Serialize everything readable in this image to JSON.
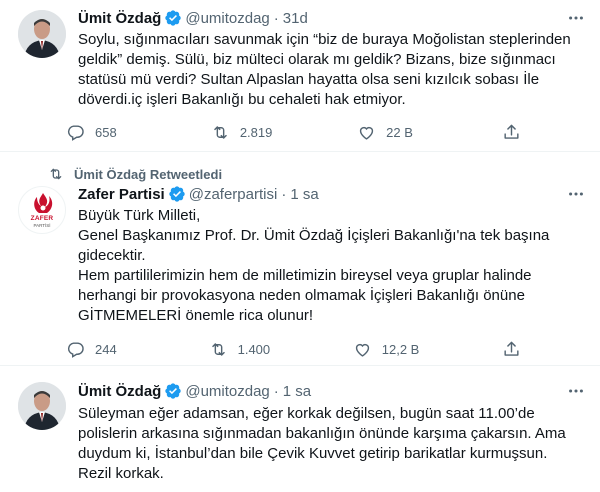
{
  "tweets": [
    {
      "name": "Ümit Özdağ",
      "handle": "@umitozdag",
      "dot": "·",
      "time": "31d",
      "text": "Soylu, sığınmacıları savunmak için “biz de buraya Moğolistan steplerinden\ngeldik” demiş. Sülü, biz mülteci olarak mı geldik? Bizans, bize sığınmacı\nstatüsü mü verdi? Sultan Alpaslan hayatta olsa seni kızılcık sobası İle\ndöverdi.iç işleri Bakanlığı bu cehaleti hak etmiyor.",
      "replies": "658",
      "retweets": "2.819",
      "likes": "22 B",
      "share": ""
    },
    {
      "retweeted_by": "Ümit Özdağ Retweetledi",
      "name": "Zafer Partisi",
      "handle": "@zaferpartisi",
      "dot": "·",
      "time": "1 sa",
      "logo_text": "ZAFER",
      "logo_subtext": "PARTİSİ",
      "text": "Büyük Türk Milleti,\nGenel Başkanımız Prof. Dr. Ümit Özdağ İçişleri Bakanlığı'na tek başına\ngidecektir.\nHem partililerimizin hem de milletimizin bireysel veya gruplar halinde\nherhangi bir provokasyona neden olmamak İçişleri Bakanlığı önüne\nGİTMEMELERİ önemle rica olunur!",
      "replies": "244",
      "retweets": "1.400",
      "likes": "12,2 B",
      "share": ""
    },
    {
      "name": "Ümit Özdağ",
      "handle": "@umitozdag",
      "dot": "·",
      "time": "1 sa",
      "text": "Süleyman eğer adamsan, eğer korkak değilsen, bugün saat 11.00’de\npolislerin arkasına sığınmadan bakanlığın önünde karşıma çakarsın. Ama\nduydum ki, İstanbul’dan bile Çevik Kuvvet getirip barikatlar kurmuşsun.\nRezil korkak."
    }
  ],
  "colors": {
    "text": "#0f1419",
    "secondary": "#536471",
    "verified": "#1d9bf0",
    "divider": "#eff3f4",
    "logo_red": "#c8102e"
  }
}
